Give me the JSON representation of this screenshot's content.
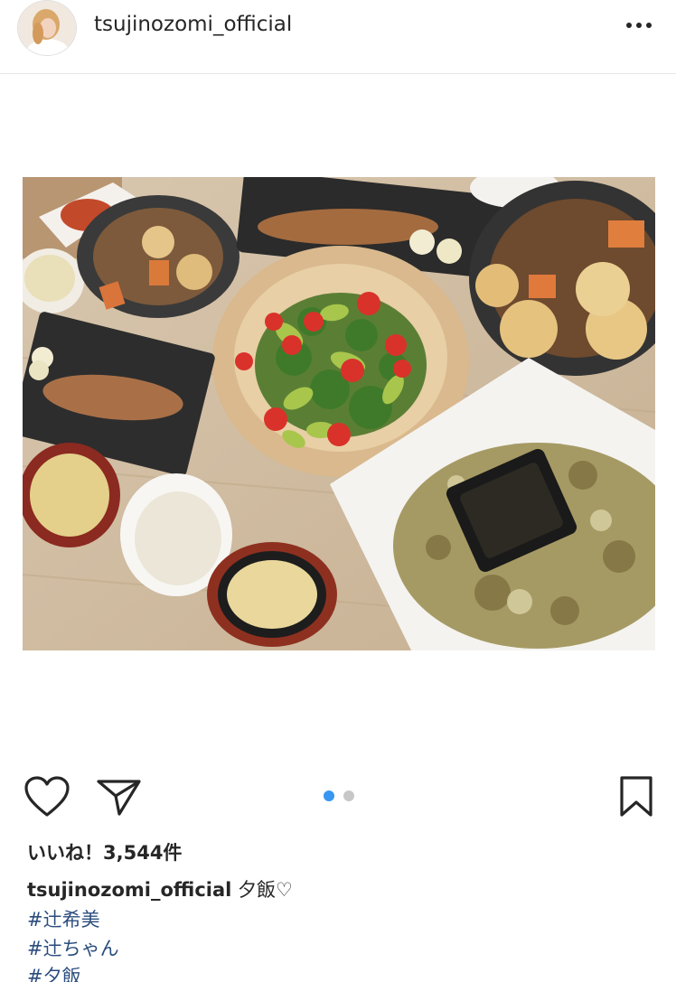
{
  "post": {
    "username": "tsujinozomi_official",
    "more_icon": "ellipsis-horizontal-icon",
    "photo_alt": "",
    "likes_text": "いいね！3,544件",
    "caption_user": "tsujinozomi_official",
    "caption_text": " 夕飯♡",
    "hashtags": [
      "#辻希美",
      "#辻ちゃん",
      "#夕飯"
    ],
    "carousel": {
      "count": 2,
      "active_index": 0
    }
  },
  "actions": {
    "like_icon": "heart-icon",
    "share_icon": "paper-plane-icon",
    "save_icon": "bookmark-icon"
  },
  "colors": {
    "active_dot": "#3897f0",
    "inactive_dot": "#c7c7c7",
    "hashtag": "#2b4c7e",
    "text": "#262626"
  }
}
